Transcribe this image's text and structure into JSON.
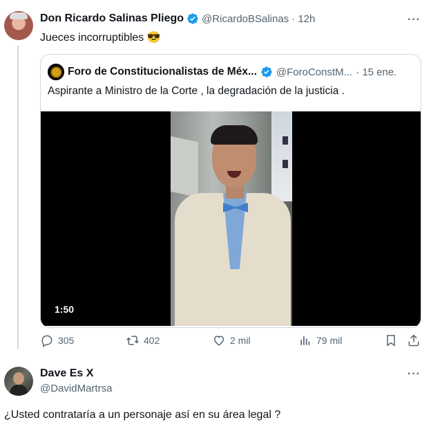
{
  "tweet": {
    "author_name": "Don Ricardo Salinas Pliego",
    "author_handle": "@RicardoBSalinas",
    "time": "· 12h",
    "text": "Jueces incorruptibles 😎",
    "more": "···"
  },
  "quoted_tweet": {
    "author_name": "Foro de Constitucionalistas de Méx...",
    "author_handle": "@ForoConstM...",
    "time": "· 15 ene.",
    "text": "Aspirante a Ministro de la Corte , la degradación de la justicia .",
    "video_duration": "1:50"
  },
  "actions": {
    "replies": "305",
    "retweets": "402",
    "likes": "2 mil",
    "views": "79 mil"
  },
  "reply": {
    "author_name": "Dave Es X",
    "author_handle": "@DavidMartrsa",
    "more": "···",
    "text": "¿Usted contrataría a un personaje así en su área legal ?"
  },
  "colors": {
    "verified": "#1d9bf0",
    "muted": "#536471",
    "border": "#cfd9de"
  }
}
